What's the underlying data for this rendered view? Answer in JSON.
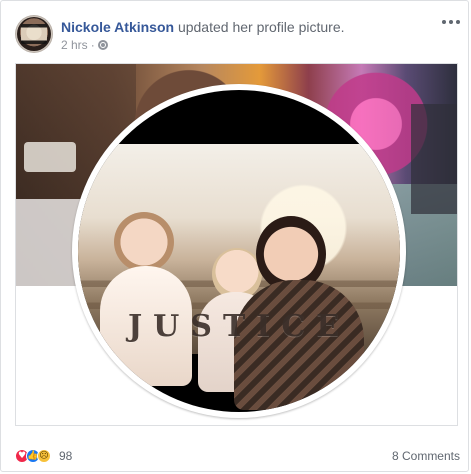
{
  "post": {
    "author": "Nickole Atkinson",
    "action": "updated her profile picture.",
    "time": "2 hrs",
    "privacy_icon": "globe-icon",
    "more_icon": "ellipsis-icon"
  },
  "profile_overlay": {
    "text": "JUSTICE"
  },
  "footer": {
    "reaction_count": "98",
    "reaction_icons": [
      "love-reaction-icon",
      "like-reaction-icon",
      "sad-reaction-icon"
    ],
    "comments": "8 Comments"
  },
  "colors": {
    "name_link": "#365899",
    "meta_text": "#90949c",
    "love": "#f0284a",
    "like": "#1877f2",
    "sad": "#f7c13a"
  }
}
